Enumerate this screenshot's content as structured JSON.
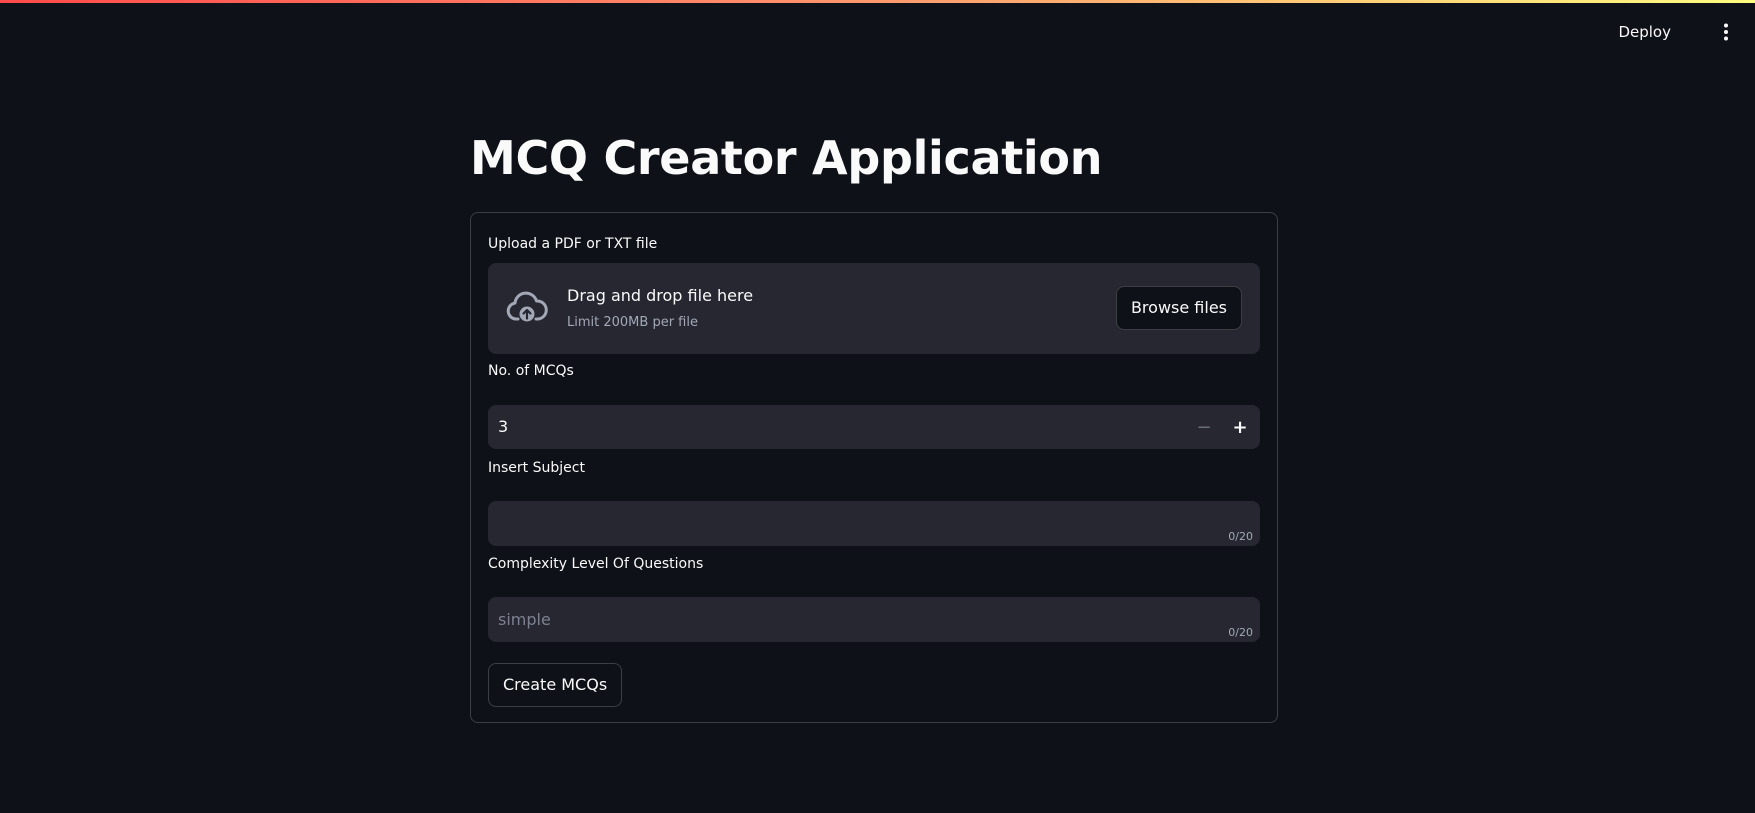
{
  "header": {
    "deploy_label": "Deploy",
    "menu_icon": "more-vertical-icon"
  },
  "page": {
    "title": "MCQ Creator Application"
  },
  "form": {
    "upload": {
      "label": "Upload a PDF or TXT file",
      "icon": "cloud-upload-icon",
      "dropzone_title": "Drag and drop file here",
      "dropzone_limit": "Limit 200MB per file",
      "browse_label": "Browse files"
    },
    "mcq_count": {
      "label": "No. of MCQs",
      "value": "3",
      "minus_label": "−",
      "plus_label": "+"
    },
    "subject": {
      "label": "Insert Subject",
      "value": "",
      "placeholder": "",
      "counter": "0/20"
    },
    "complexity": {
      "label": "Complexity Level Of Questions",
      "value": "",
      "placeholder": "simple",
      "counter": "0/20"
    },
    "submit_label": "Create MCQs"
  },
  "colors": {
    "background": "#0e1117",
    "input_bg": "#262730",
    "text": "#fafafa",
    "muted_text": "#a3a8b8",
    "accent_stripe_start": "#ff4b4b",
    "accent_stripe_end": "#fffd80"
  }
}
